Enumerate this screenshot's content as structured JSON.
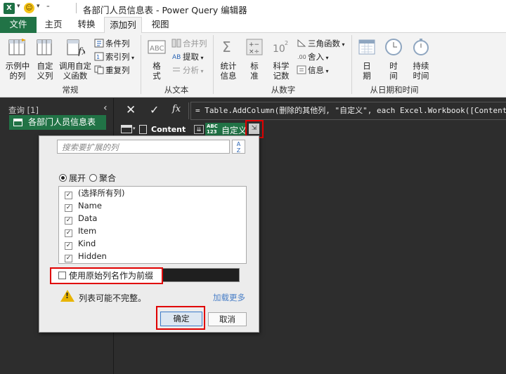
{
  "titlebar": {
    "title": "各部门人员信息表 - Power Query 编辑器",
    "app_icon": "X"
  },
  "tabs": [
    {
      "label": "文件"
    },
    {
      "label": "主页"
    },
    {
      "label": "转换"
    },
    {
      "label": "添加列",
      "active": true
    },
    {
      "label": "视图"
    }
  ],
  "ribbon": {
    "general": {
      "label": "常规",
      "col_from_examples": "示例中\n的列",
      "custom_column": "自定\n义列",
      "invoke_function": "调用自定\n义函数",
      "conditional": "条件列",
      "index": "索引列",
      "duplicate": "重复列"
    },
    "from_text": {
      "label": "从文本",
      "format": "格\n式",
      "merge": "合并列",
      "extract": "提取",
      "parse": "分析"
    },
    "from_number": {
      "label": "从数字",
      "statistics": "统计\n信息",
      "standard": "标\n准",
      "scientific": "科学\n记数",
      "trig": "三角函数",
      "rounding": "舍入",
      "info": "信息"
    },
    "from_datetime": {
      "label": "从日期和时间",
      "date": "日\n期",
      "time": "时\n间",
      "duration": "持续\n时间"
    }
  },
  "queries": {
    "header": "查询 [1]",
    "items": [
      "各部门人员信息表"
    ]
  },
  "formula_bar": {
    "fx": "fx",
    "formula": "= Table.AddColumn(删除的其他列, \"自定义\", each Excel.Workbook([Content],true"
  },
  "grid": {
    "col1": "Content",
    "col2": "自定义",
    "type_badge": "ABC\n123"
  },
  "expand_dialog": {
    "search_placeholder": "搜索要扩展的列",
    "sort_glyph": "A\nZ",
    "mode_expand": "展开",
    "mode_aggregate": "聚合",
    "columns": [
      {
        "label": "(选择所有列)",
        "checked": true
      },
      {
        "label": "Name",
        "checked": true
      },
      {
        "label": "Data",
        "checked": true
      },
      {
        "label": "Item",
        "checked": true
      },
      {
        "label": "Kind",
        "checked": true
      },
      {
        "label": "Hidden",
        "checked": true
      }
    ],
    "use_prefix": "使用原始列名作为前缀",
    "warning": "列表可能不完整。",
    "load_more": "加载更多",
    "ok": "确定",
    "cancel": "取消"
  }
}
